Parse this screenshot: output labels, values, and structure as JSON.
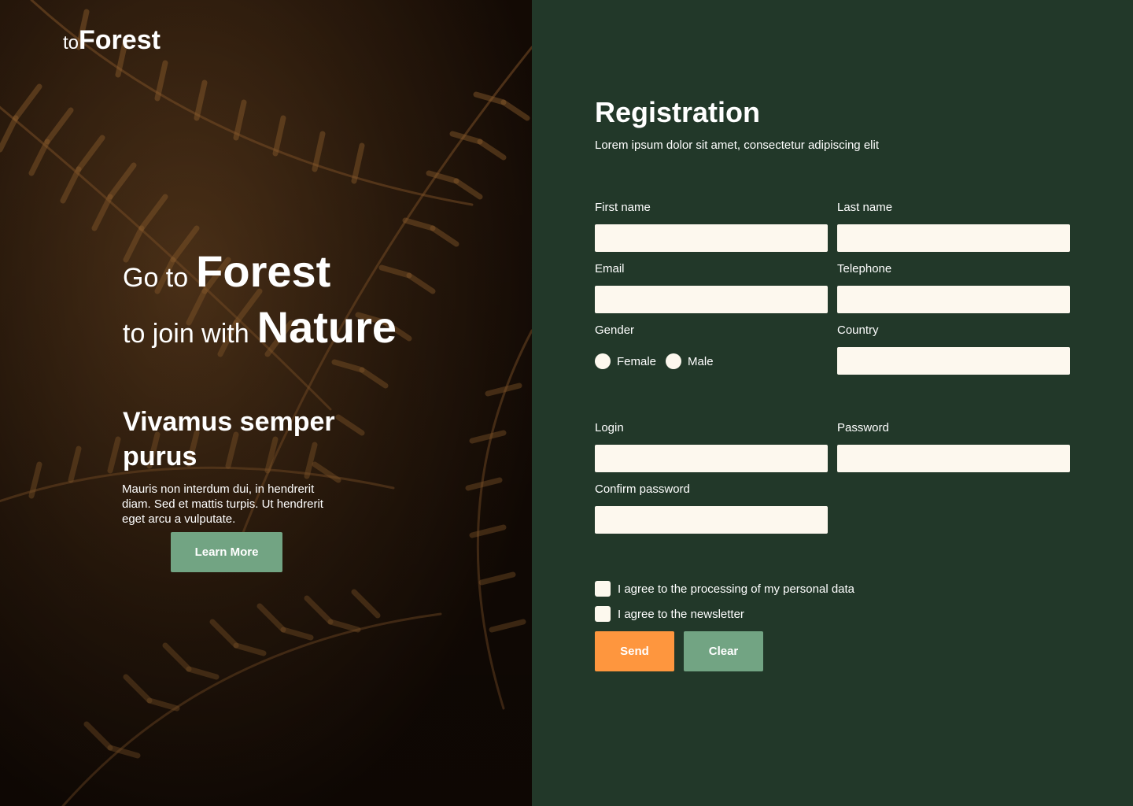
{
  "logo": {
    "prefix": "to",
    "name": "Forest"
  },
  "hero": {
    "line1_small": "Go to",
    "line1_big": "Forest",
    "line2_small": "to join with",
    "line2_big": "Nature",
    "heading": "Vivamus semper purus",
    "text": "Mauris non interdum dui, in hendrerit diam. Sed et mattis turpis. Ut hendrerit eget arcu a vulputate.",
    "button": "Learn More"
  },
  "form": {
    "title": "Registration",
    "subtitle": "Lorem ipsum dolor sit amet, consectetur adipiscing elit",
    "fields": {
      "first_name": "First name",
      "last_name": "Last name",
      "email": "Email",
      "telephone": "Telephone",
      "gender": "Gender",
      "country": "Country",
      "login": "Login",
      "password": "Password",
      "confirm_password": "Confirm password"
    },
    "gender_options": [
      "Female",
      "Male"
    ],
    "consent_data": "I agree to the processing of my personal data",
    "consent_newsletter": "I agree to the newsletter",
    "send": "Send",
    "clear": "Clear"
  },
  "colors": {
    "panel": "#223829",
    "input": "#fdf8ee",
    "accent_orange": "#fe963e",
    "accent_green": "#72a483",
    "photo_dark": "#1f1209"
  }
}
